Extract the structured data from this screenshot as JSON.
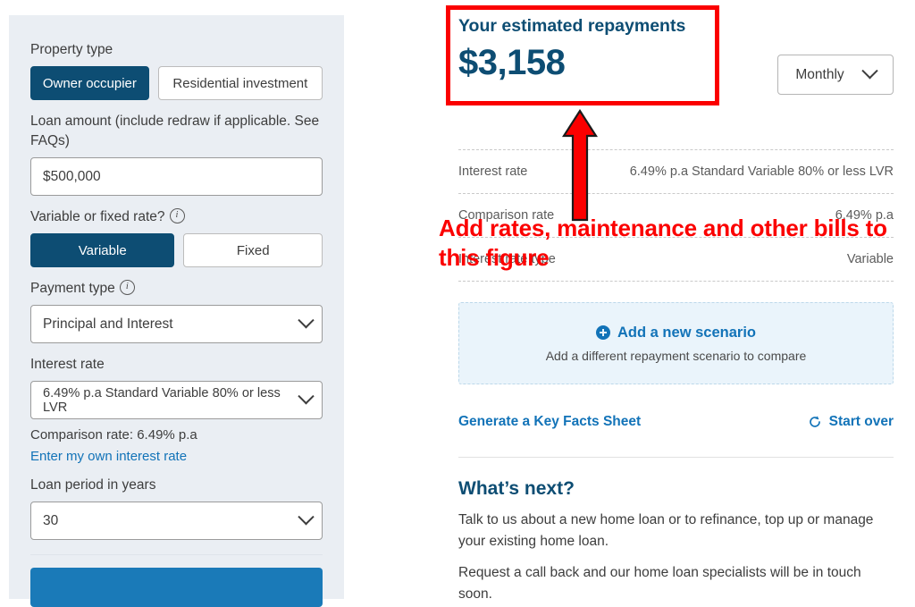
{
  "calculator": {
    "property_type": {
      "label": "Property type",
      "options": [
        "Owner occupier",
        "Residential investment"
      ],
      "selected": "Owner occupier"
    },
    "loan_amount": {
      "label": "Loan amount (include redraw if applicable. See FAQs)",
      "value": "$500,000"
    },
    "rate_type": {
      "label": "Variable or fixed rate?",
      "info_icon": "info-icon",
      "options": [
        "Variable",
        "Fixed"
      ],
      "selected": "Variable"
    },
    "payment_type": {
      "label": "Payment type",
      "info_icon": "info-icon",
      "value": "Principal and Interest",
      "chevron_icon": "chevron-down-icon"
    },
    "interest_rate": {
      "label": "Interest rate",
      "value": "6.49% p.a Standard Variable 80% or less LVR",
      "chevron_icon": "chevron-down-icon"
    },
    "comparison_note": "Comparison rate: 6.49% p.a",
    "own_rate_link": "Enter my own interest rate",
    "loan_period": {
      "label": "Loan period in years",
      "value": "30",
      "chevron_icon": "chevron-down-icon"
    }
  },
  "results": {
    "estimate_title": "Your estimated repayments",
    "estimate_amount": "$3,158",
    "frequency": {
      "value": "Monthly",
      "chevron_icon": "chevron-down-icon"
    },
    "rates": [
      {
        "label": "Interest rate",
        "value": "6.49% p.a Standard Variable 80% or less LVR"
      },
      {
        "label": "Comparison rate",
        "value": "6.49% p.a"
      },
      {
        "label": "Interest rate type",
        "value": "Variable"
      }
    ],
    "scenario": {
      "plus_icon": "plus-circle-icon",
      "title": "Add a new scenario",
      "subtitle": "Add a different repayment scenario to compare"
    },
    "actions": {
      "key_facts": "Generate a Key Facts Sheet",
      "start_over": "Start over",
      "start_over_icon": "refresh-icon"
    },
    "whats_next": {
      "title": "What’s next?",
      "paragraphs": [
        "Talk to us about a new home loan or to refinance, top up or manage your existing home loan.",
        "Request a call back and our home loan specialists will be in touch soon."
      ]
    }
  },
  "annotation": {
    "text": "Add rates, maintenance and other bills to this figure",
    "highlight_color": "#fb0000",
    "arrow_icon": "up-arrow-icon"
  },
  "colors": {
    "brand_dark_blue": "#0d4d73",
    "brand_blue": "#1273b8",
    "panel_bg": "#eaeef3",
    "annotation_red": "#fb0000"
  }
}
